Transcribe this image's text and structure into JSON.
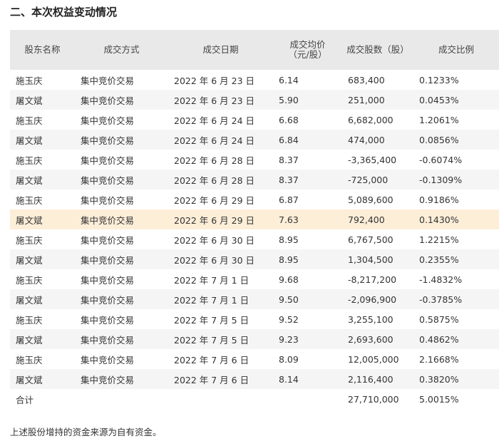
{
  "title": "二、本次权益变动情况",
  "headers": [
    "股东名称",
    "成交方式",
    "成交日期",
    "成交均价（元/股）",
    "成交股数（股）",
    "成交比例"
  ],
  "rows": [
    [
      "施玉庆",
      "集中竞价交易",
      "2022 年 6 月 23 日",
      "6.14",
      "683,400",
      "0.1233%"
    ],
    [
      "屠文斌",
      "集中竞价交易",
      "2022 年 6 月 23 日",
      "5.90",
      "251,000",
      "0.0453%"
    ],
    [
      "施玉庆",
      "集中竞价交易",
      "2022 年 6 月 24 日",
      "6.68",
      "6,682,000",
      "1.2061%"
    ],
    [
      "屠文斌",
      "集中竞价交易",
      "2022 年 6 月 24 日",
      "6.84",
      "474,000",
      "0.0856%"
    ],
    [
      "施玉庆",
      "集中竞价交易",
      "2022 年 6 月 28 日",
      "8.37",
      "-3,365,400",
      "-0.6074%"
    ],
    [
      "屠文斌",
      "集中竞价交易",
      "2022 年 6 月 28 日",
      "8.37",
      "-725,000",
      "-0.1309%"
    ],
    [
      "施玉庆",
      "集中竞价交易",
      "2022 年 6 月 29 日",
      "6.87",
      "5,089,600",
      "0.9186%"
    ],
    [
      "屠文斌",
      "集中竞价交易",
      "2022 年 6 月 29 日",
      "7.63",
      "792,400",
      "0.1430%"
    ],
    [
      "施玉庆",
      "集中竞价交易",
      "2022 年 6 月 30 日",
      "8.95",
      "6,767,500",
      "1.2215%"
    ],
    [
      "屠文斌",
      "集中竞价交易",
      "2022 年 6 月 30 日",
      "8.95",
      "1,304,500",
      "0.2355%"
    ],
    [
      "施玉庆",
      "集中竞价交易",
      "2022 年 7 月 1 日",
      "9.68",
      "-8,217,200",
      "-1.4832%"
    ],
    [
      "屠文斌",
      "集中竞价交易",
      "2022 年 7 月 1 日",
      "9.50",
      "-2,096,900",
      "-0.3785%"
    ],
    [
      "施玉庆",
      "集中竞价交易",
      "2022 年 7 月 5 日",
      "9.52",
      "3,255,100",
      "0.5875%"
    ],
    [
      "屠文斌",
      "集中竞价交易",
      "2022 年 7 月 5 日",
      "9.23",
      "2,693,600",
      "0.4862%"
    ],
    [
      "施玉庆",
      "集中竞价交易",
      "2022 年 7 月 6 日",
      "8.09",
      "12,005,000",
      "2.1668%"
    ],
    [
      "屠文斌",
      "集中竞价交易",
      "2022 年 7 月 6 日",
      "8.14",
      "2,116,400",
      "0.3820%"
    ]
  ],
  "highlight_row": 7,
  "total": {
    "label": "合计",
    "shares": "27,710,000",
    "ratio": "5.0015%"
  },
  "note": "上述股份增持的资金来源为自有资金。"
}
